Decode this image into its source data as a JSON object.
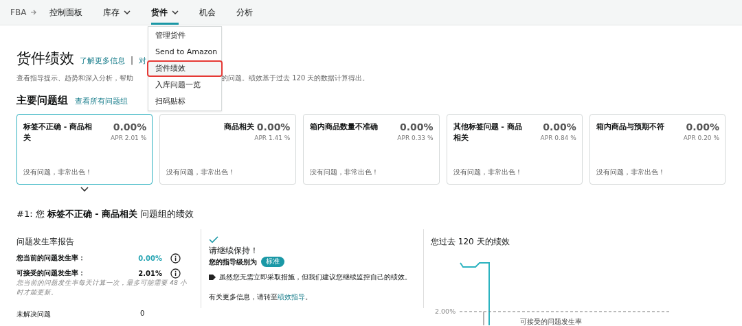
{
  "nav": {
    "root": "FBA",
    "items": [
      {
        "label": "控制面板",
        "dropdown": false,
        "selected": false
      },
      {
        "label": "库存",
        "dropdown": true,
        "selected": false
      },
      {
        "label": "货件",
        "dropdown": true,
        "selected": true
      },
      {
        "label": "机会",
        "dropdown": false,
        "selected": false
      },
      {
        "label": "分析",
        "dropdown": false,
        "selected": false
      }
    ]
  },
  "menu": {
    "items": [
      {
        "label": "管理货件",
        "selected": false
      },
      {
        "label": "Send to Amazon",
        "selected": false
      },
      {
        "label": "货件绩效",
        "selected": true
      },
      {
        "label": "入库问题一览",
        "selected": false
      },
      {
        "label": "扫码贴标",
        "selected": false
      }
    ]
  },
  "header": {
    "title": "货件绩效",
    "links": [
      "了解更多信息",
      "对"
    ],
    "separator": "|",
    "description": [
      "查看指导提示、趋势和深入分析，帮助",
      "的问题。绩效基于过去 120 天的数据计算得出。"
    ]
  },
  "top_issues": {
    "title": "主要问题组",
    "link": "查看所有问题组",
    "cards": [
      {
        "title": "标签不正确 - 商品相关",
        "rate": "0.00%",
        "apr": "APR 2.01 %",
        "status": "没有问题，非常出色！",
        "selected": true
      },
      {
        "title": "商品相关",
        "rate": "0.00%",
        "apr": "APR 1.41 %",
        "status": "没有问题，非常出色！",
        "selected": false
      },
      {
        "title": "箱内商品数量不准确",
        "rate": "0.00%",
        "apr": "APR 0.33 %",
        "status": "没有问题，非常出色！",
        "selected": false
      },
      {
        "title": "其他标签问题 - 商品相关",
        "rate": "0.00%",
        "apr": "APR 0.84 %",
        "status": "没有问题，非常出色！",
        "selected": false
      },
      {
        "title": "箱内商品与预期不符",
        "rate": "0.00%",
        "apr": "APR 0.20 %",
        "status": "没有问题，非常出色！",
        "selected": false
      }
    ]
  },
  "section_heading": "#1: 您 **标签不正确 - 商品相关** 问题组的绩效",
  "report": {
    "title": "问题发生率报告",
    "rows": [
      {
        "label": "您当前的问题发生率：",
        "value": "0.00%",
        "kind": "current"
      },
      {
        "label": "可接受的问题发生率：",
        "value": "2.01%",
        "kind": "acceptable"
      }
    ],
    "note": "您当前的问题发生率每天计算一次，最多可能需要 48 小时才能更新。",
    "unresolved": {
      "label": "未解决问题",
      "value": "0"
    }
  },
  "guidance": {
    "title": "请继续保持！",
    "level_label": "您的指导级别为",
    "badge": "标准",
    "bullet": "虽然您无需立即采取措施，但我们建议您继续监控自己的绩效。",
    "more_info": "有关更多信息，请转至",
    "link": "绩效指导",
    "end": "。"
  },
  "chart": {
    "title": "您过去 120 天的绩效",
    "reference_value": "2.00%",
    "reference_label": "可接受的问题发生率"
  }
}
